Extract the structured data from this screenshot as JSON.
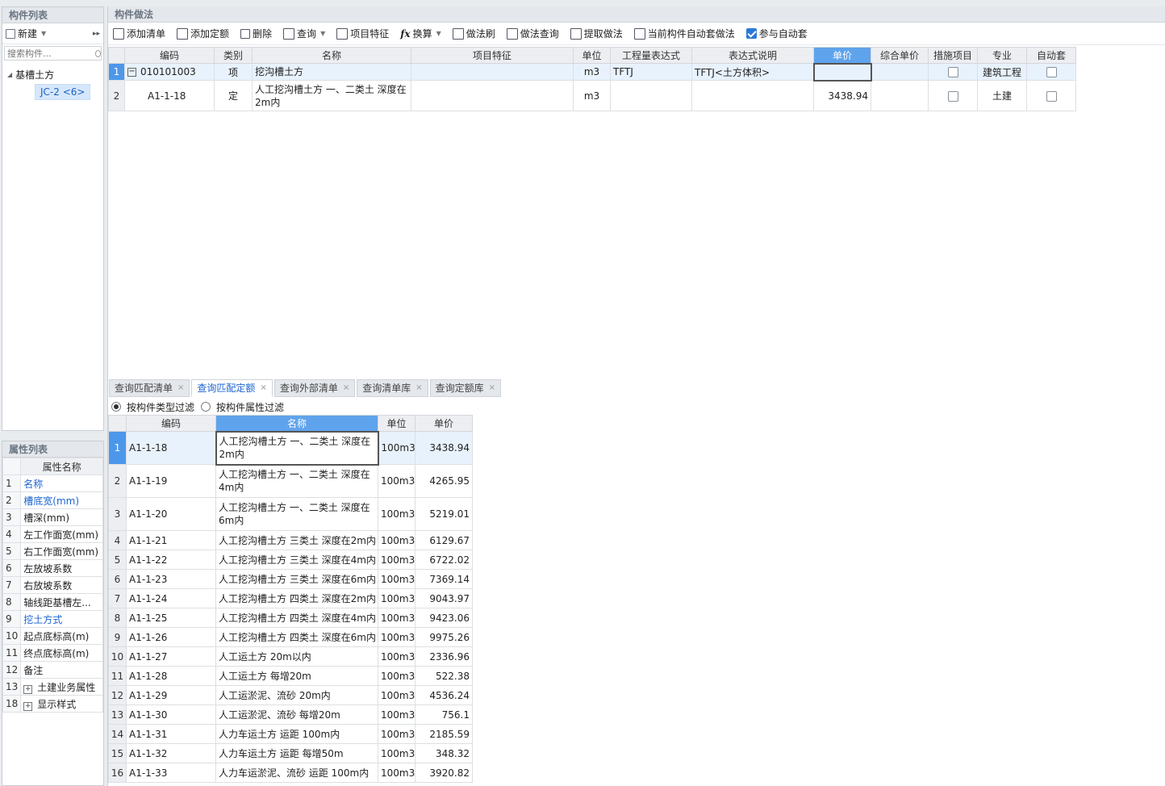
{
  "component_list": {
    "title": "构件列表",
    "new_label": "新建",
    "search_placeholder": "搜索构件...",
    "tree_root": "基槽土方",
    "tree_child": "JC-2 <6>"
  },
  "property_list": {
    "title": "属性列表",
    "header": "属性名称",
    "rows": [
      {
        "num": "1",
        "name": "名称",
        "blue": true
      },
      {
        "num": "2",
        "name": "槽底宽(mm)",
        "blue": true
      },
      {
        "num": "3",
        "name": "槽深(mm)",
        "blue": false
      },
      {
        "num": "4",
        "name": "左工作面宽(mm)",
        "blue": false
      },
      {
        "num": "5",
        "name": "右工作面宽(mm)",
        "blue": false
      },
      {
        "num": "6",
        "name": "左放坡系数",
        "blue": false
      },
      {
        "num": "7",
        "name": "右放坡系数",
        "blue": false
      },
      {
        "num": "8",
        "name": "轴线距基槽左...",
        "blue": false
      },
      {
        "num": "9",
        "name": "挖土方式",
        "blue": true
      },
      {
        "num": "10",
        "name": "起点底标高(m)",
        "blue": false
      },
      {
        "num": "11",
        "name": "终点底标高(m)",
        "blue": false
      },
      {
        "num": "12",
        "name": "备注",
        "blue": false
      },
      {
        "num": "13",
        "name": "土建业务属性",
        "blue": false,
        "expand": true
      },
      {
        "num": "18",
        "name": "显示样式",
        "blue": false,
        "expand": true
      }
    ]
  },
  "method": {
    "title": "构件做法",
    "toolbar": {
      "add_list": "添加清单",
      "add_quota": "添加定额",
      "delete": "删除",
      "query": "查询",
      "item_feature": "项目特征",
      "convert": "换算",
      "method_brush": "做法刷",
      "method_query": "做法查询",
      "extract_method": "提取做法",
      "auto_method": "当前构件自动套做法",
      "auto_join": "参与自动套"
    },
    "headers": [
      "编码",
      "类别",
      "名称",
      "项目特征",
      "单位",
      "工程量表达式",
      "表达式说明",
      "单价",
      "综合单价",
      "措施项目",
      "专业",
      "自动套"
    ],
    "rows": [
      {
        "rn": "1",
        "code": "010101003",
        "type": "项",
        "name": "挖沟槽土方",
        "feature": "",
        "unit": "m3",
        "expr": "TFTJ",
        "expr_desc": "TFTJ<土方体积>",
        "price": "",
        "comp_price": "",
        "major": "建筑工程"
      },
      {
        "rn": "2",
        "code": "A1-1-18",
        "type": "定",
        "name": "人工挖沟槽土方 一、二类土 深度在2m内",
        "feature": "",
        "unit": "m3",
        "expr": "",
        "expr_desc": "",
        "price": "3438.94",
        "comp_price": "",
        "major": "土建"
      }
    ]
  },
  "tabs": [
    {
      "label": "查询匹配清单",
      "on": false
    },
    {
      "label": "查询匹配定额",
      "on": true
    },
    {
      "label": "查询外部清单",
      "on": false
    },
    {
      "label": "查询清单库",
      "on": false
    },
    {
      "label": "查询定额库",
      "on": false
    }
  ],
  "filters": {
    "by_type": "按构件类型过滤",
    "by_attr": "按构件属性过滤"
  },
  "quota": {
    "headers": [
      "编码",
      "名称",
      "单位",
      "单价"
    ],
    "rows": [
      {
        "rn": "1",
        "code": "A1-1-18",
        "name": "人工挖沟槽土方 一、二类土 深度在2m内",
        "unit": "100m3",
        "price": "3438.94",
        "tall": true
      },
      {
        "rn": "2",
        "code": "A1-1-19",
        "name": "人工挖沟槽土方 一、二类土 深度在4m内",
        "unit": "100m3",
        "price": "4265.95",
        "tall": true
      },
      {
        "rn": "3",
        "code": "A1-1-20",
        "name": "人工挖沟槽土方 一、二类土 深度在6m内",
        "unit": "100m3",
        "price": "5219.01",
        "tall": true
      },
      {
        "rn": "4",
        "code": "A1-1-21",
        "name": "人工挖沟槽土方 三类土 深度在2m内",
        "unit": "100m3",
        "price": "6129.67"
      },
      {
        "rn": "5",
        "code": "A1-1-22",
        "name": "人工挖沟槽土方 三类土 深度在4m内",
        "unit": "100m3",
        "price": "6722.02"
      },
      {
        "rn": "6",
        "code": "A1-1-23",
        "name": "人工挖沟槽土方 三类土 深度在6m内",
        "unit": "100m3",
        "price": "7369.14"
      },
      {
        "rn": "7",
        "code": "A1-1-24",
        "name": "人工挖沟槽土方 四类土 深度在2m内",
        "unit": "100m3",
        "price": "9043.97"
      },
      {
        "rn": "8",
        "code": "A1-1-25",
        "name": "人工挖沟槽土方 四类土 深度在4m内",
        "unit": "100m3",
        "price": "9423.06"
      },
      {
        "rn": "9",
        "code": "A1-1-26",
        "name": "人工挖沟槽土方 四类土 深度在6m内",
        "unit": "100m3",
        "price": "9975.26"
      },
      {
        "rn": "10",
        "code": "A1-1-27",
        "name": "人工运土方 20m以内",
        "unit": "100m3",
        "price": "2336.96"
      },
      {
        "rn": "11",
        "code": "A1-1-28",
        "name": "人工运土方 每增20m",
        "unit": "100m3",
        "price": "522.38"
      },
      {
        "rn": "12",
        "code": "A1-1-29",
        "name": "人工运淤泥、流砂 20m内",
        "unit": "100m3",
        "price": "4536.24"
      },
      {
        "rn": "13",
        "code": "A1-1-30",
        "name": "人工运淤泥、流砂 每增20m",
        "unit": "100m3",
        "price": "756.1"
      },
      {
        "rn": "14",
        "code": "A1-1-31",
        "name": "人力车运土方 运距 100m内",
        "unit": "100m3",
        "price": "2185.59"
      },
      {
        "rn": "15",
        "code": "A1-1-32",
        "name": "人力车运土方 运距 每增50m",
        "unit": "100m3",
        "price": "348.32"
      },
      {
        "rn": "16",
        "code": "A1-1-33",
        "name": "人力车运淤泥、流砂 运距 100m内",
        "unit": "100m3",
        "price": "3920.82"
      }
    ]
  }
}
